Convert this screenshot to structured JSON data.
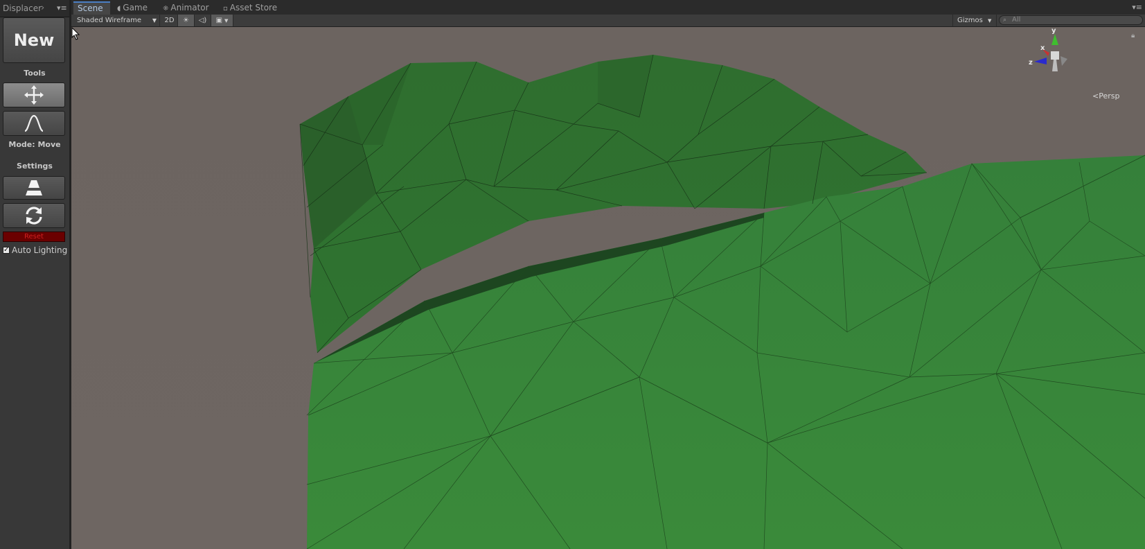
{
  "left_panel": {
    "tab_title": "Displacer",
    "new_label": "New",
    "tools_label": "Tools",
    "mode_label": "Mode: Move",
    "settings_label": "Settings",
    "reset_label": "Reset",
    "auto_lighting_label": "Auto Lighting",
    "auto_lighting_checked": true
  },
  "scene_tabs": [
    {
      "label": "Scene",
      "active": true
    },
    {
      "label": "Game",
      "icon": "pacman-icon"
    },
    {
      "label": "Animator",
      "icon": "animator-icon"
    },
    {
      "label": "Asset Store",
      "icon": "store-icon"
    }
  ],
  "toolbar": {
    "shading_mode": "Shaded Wireframe",
    "mode_2d": "2D",
    "gizmos_label": "Gizmos",
    "search_placeholder": "All"
  },
  "viewport": {
    "projection_label": "Persp",
    "axes": {
      "x": "x",
      "y": "y",
      "z": "z"
    },
    "background_color": "#6e6662",
    "terrain_color": "#357f35"
  }
}
